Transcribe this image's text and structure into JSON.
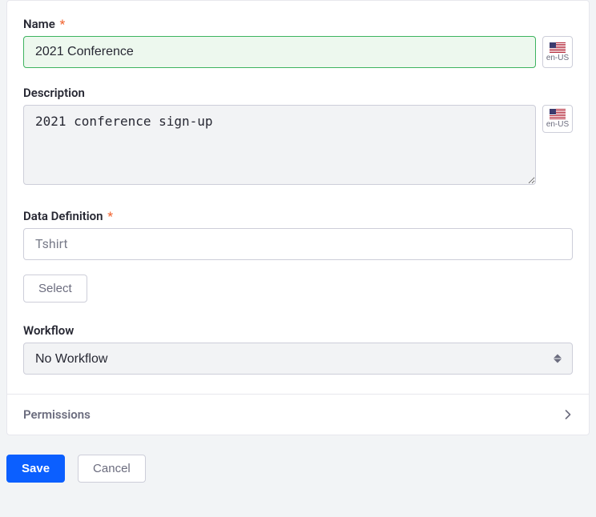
{
  "fields": {
    "name": {
      "label": "Name",
      "required": true,
      "value": "2021 Conference",
      "locale": "en-US"
    },
    "description": {
      "label": "Description",
      "value": "2021 conference sign-up",
      "locale": "en-US"
    },
    "data_definition": {
      "label": "Data Definition",
      "required": true,
      "value": "Tshirt",
      "select_button": "Select"
    },
    "workflow": {
      "label": "Workflow",
      "selected": "No Workflow",
      "options": [
        "No Workflow"
      ]
    }
  },
  "sections": {
    "permissions": {
      "title": "Permissions"
    }
  },
  "actions": {
    "save": "Save",
    "cancel": "Cancel"
  }
}
